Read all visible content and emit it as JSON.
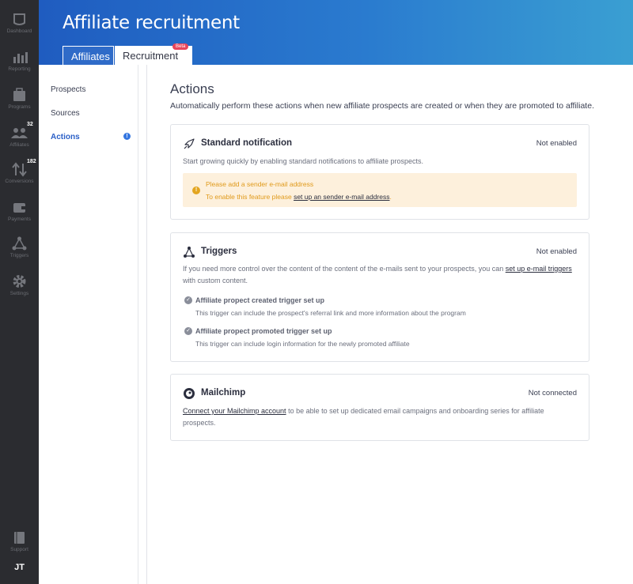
{
  "rail": {
    "items": [
      {
        "label": "Dashboard",
        "icon": "dashboard-icon"
      },
      {
        "label": "Reporting",
        "icon": "bar-chart-icon"
      },
      {
        "label": "Programs",
        "icon": "briefcase-icon"
      },
      {
        "label": "Affiliates",
        "icon": "users-icon",
        "badge": "32"
      },
      {
        "label": "Conversions",
        "icon": "arrows-updown-icon",
        "badge": "182"
      },
      {
        "label": "Payments",
        "icon": "wallet-icon"
      },
      {
        "label": "Triggers",
        "icon": "triggers-icon"
      },
      {
        "label": "Settings",
        "icon": "gear-icon"
      },
      {
        "label": "Support",
        "icon": "book-icon"
      }
    ],
    "avatar": "JT"
  },
  "header": {
    "title": "Affiliate recruitment",
    "tabs": [
      {
        "label": "Affiliates"
      },
      {
        "label": "Recruitment",
        "badge": "Beta"
      }
    ]
  },
  "subnav": {
    "items": [
      {
        "label": "Prospects"
      },
      {
        "label": "Sources"
      },
      {
        "label": "Actions",
        "badge": "!"
      }
    ]
  },
  "main": {
    "title": "Actions",
    "subtitle": "Automatically perform these actions when new affiliate prospects are created or when they are promoted to affiliate.",
    "cards": {
      "standard": {
        "title": "Standard notification",
        "status": "Not enabled",
        "text": "Start growing quickly by enabling standard notifications to affiliate prospects.",
        "warning_title": "Please add a sender e-mail address",
        "warning_text_pre": "To enable this feature please ",
        "warning_link": "set up an sender e-mail address",
        "warning_text_post": "."
      },
      "triggers": {
        "title": "Triggers",
        "status": "Not enabled",
        "text_pre": "If you need more control over the content of the content of the e-mails sent to your prospects, you can ",
        "text_link": "set up e-mail triggers",
        "text_line2": "with custom content.",
        "items": [
          {
            "title": "Affiliate propect created trigger set up",
            "desc": "This trigger can include the prospect's referral link and more information about the program"
          },
          {
            "title": "Affiliate propect promoted trigger set up",
            "desc": "This trigger can include login information for the newly promoted affiliate"
          }
        ]
      },
      "mailchimp": {
        "title": "Mailchimp",
        "status": "Not connected",
        "link": "Connect your Mailchimp account",
        "text_post": " to be able to set up dedicated email campaigns and onboarding series for affiliate",
        "text_line2": "prospects."
      }
    }
  },
  "colors": {
    "rail": "#2b2c30",
    "header_start": "#1f5cc0",
    "header_end": "#3a9fd2",
    "accent": "#2a5fc7",
    "beta": "#e8455b",
    "warning_bg": "#fdf0dc",
    "warning_text": "#e09a1b"
  }
}
